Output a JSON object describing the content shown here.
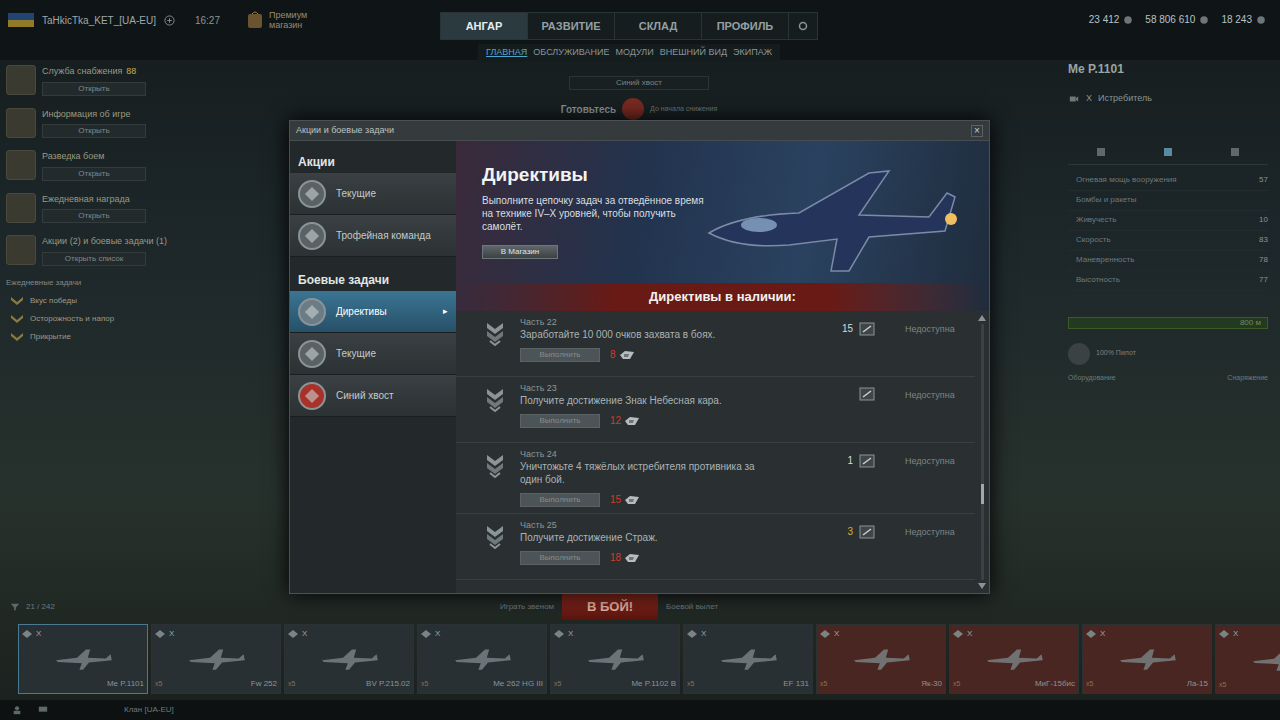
{
  "top_bar": {
    "player": "TaHkicTka_KET_[UA-EU]",
    "time": "16:27",
    "premium": "Премиум",
    "premium_sub": "магазин",
    "nav": [
      {
        "label": "АНГАР",
        "selected": true
      },
      {
        "label": "РАЗВИТИЕ",
        "selected": false
      },
      {
        "label": "СКЛАД",
        "selected": false
      },
      {
        "label": "ПРОФИЛЬ",
        "selected": false
      }
    ],
    "subnav": [
      {
        "label": "ГЛАВНАЯ",
        "selected": true
      },
      {
        "label": "ОБСЛУЖИВАНИЕ",
        "selected": false
      },
      {
        "label": "МОДУЛИ",
        "selected": false
      },
      {
        "label": "ВНЕШНИЙ ВИД",
        "selected": false
      },
      {
        "label": "ЭКИПАЖ",
        "selected": false
      }
    ],
    "currencies": [
      "23 412",
      "58 806 610",
      "18 243"
    ]
  },
  "event": {
    "title": "Синий хвост",
    "status": "Готовьтесь",
    "note": "До начала снижения"
  },
  "sidebar": {
    "items": [
      {
        "title": "Служба снабжения",
        "badge": "88",
        "button": "Открыть"
      },
      {
        "title": "Информация об игре",
        "button": "Открыть"
      },
      {
        "title": "Разведка боем",
        "button": "Открыть"
      },
      {
        "title": "Ежедневная награда",
        "button": "Открыть"
      },
      {
        "title": "Акции (2) и боевые задачи (1)",
        "button": "Открыть список"
      }
    ],
    "daily_heading": "Ежедневные задачи",
    "daily_tasks": [
      "Вкус победы",
      "Осторожность и напор",
      "Прикрытие"
    ]
  },
  "vehicle": {
    "name": "Me P.1101",
    "tier": "X",
    "class": "Истребитель",
    "stats": [
      {
        "label": "Огневая мощь вооружения",
        "value": "57"
      },
      {
        "label": "Бомбы и ракеты"
      },
      {
        "label": "Живучесть",
        "value": "10"
      },
      {
        "label": "Скорость",
        "value": "83"
      },
      {
        "label": "Маневренность",
        "value": "78"
      },
      {
        "label": "Высотность",
        "value": "77"
      }
    ],
    "altitude": {
      "label": "800 м",
      "level": 1
    },
    "pilot": "100% Пилот",
    "equipment": "Оборудование",
    "consumables": "Снаряжение"
  },
  "modal": {
    "title": "Акции и боевые задачи",
    "close": "×",
    "menu_arrow": "▸",
    "sections": [
      {
        "heading": "Акции",
        "items": [
          {
            "label": "Текущие",
            "selected": false,
            "color": "#5a6265"
          },
          {
            "label": "Трофейная команда",
            "selected": false,
            "color": "#5a6265"
          }
        ]
      },
      {
        "heading": "Боевые задачи",
        "items": [
          {
            "label": "Директивы",
            "selected": true,
            "color": "#6c7c86"
          },
          {
            "label": "Текущие",
            "selected": false,
            "color": "#5a6265"
          },
          {
            "label": "Синий хвост",
            "selected": false,
            "color": "#a8322a"
          }
        ]
      }
    ],
    "banner": {
      "title": "Директивы",
      "description": "Выполните цепочку задач за отведённое время на технике IV–X уровней, чтобы получить самолёт.",
      "button": "В Магазин",
      "footer": "Директивы в наличии:"
    },
    "rows": [
      {
        "part": "Часть 22",
        "task": "Заработайте 10 000 очков захвата в боях.",
        "button": "Выполнить",
        "disabled": true,
        "reward": "8",
        "progress": "15",
        "progress_color": "#d6dcdc",
        "status": "Недоступна"
      },
      {
        "part": "Часть 23",
        "task": "Получите достижение Знак Небесная кара.",
        "button": "Выполнить",
        "disabled": true,
        "reward": "12",
        "status": "Недоступна"
      },
      {
        "part": "Часть 24",
        "task": "Уничтожьте 4 тяжёлых истребителя противника за один бой.",
        "button": "Выполнить",
        "disabled": true,
        "reward": "15",
        "progress": "1",
        "progress_color": "#d6dcdc",
        "status": "Недоступна"
      },
      {
        "part": "Часть 25",
        "task": "Получите достижение Страж.",
        "button": "Выполнить",
        "disabled": true,
        "reward": "18",
        "progress": "3",
        "progress_color": "#d8b040",
        "status": "Недоступна"
      }
    ],
    "scrollbar": {
      "level": 0.68
    }
  },
  "battle": {
    "button": "В БОЙ!",
    "left": "Играть звеном",
    "right": "Боевой вылет",
    "count": "21 / 242"
  },
  "carousel": [
    {
      "name": "Me P.1101",
      "tier": "X",
      "selected": true,
      "color": "#283034"
    },
    {
      "name": "Fw 252",
      "tier": "X",
      "count": "x5",
      "selected": false,
      "color": "#283034"
    },
    {
      "name": "BV P.215.02",
      "tier": "X",
      "count": "x5",
      "selected": false,
      "color": "#283034"
    },
    {
      "name": "Me 262 HG III",
      "tier": "X",
      "count": "x5",
      "selected": false,
      "color": "#283034"
    },
    {
      "name": "Me P.1102 B",
      "tier": "X",
      "count": "x5",
      "selected": false,
      "color": "#283034"
    },
    {
      "name": "EF 131",
      "tier": "X",
      "count": "x5",
      "selected": false,
      "color": "#283034"
    },
    {
      "name": "Як-30",
      "tier": "X",
      "count": "x5",
      "selected": false,
      "color": "#4a2622"
    },
    {
      "name": "МиГ-15бис",
      "tier": "X",
      "count": "x5",
      "selected": false,
      "color": "#4a2622"
    },
    {
      "name": "Ла-15",
      "tier": "X",
      "count": "x5",
      "selected": false,
      "color": "#4a2622"
    },
    {
      "tier": "X",
      "count": "x5",
      "selected": false,
      "color": "#4a2622"
    }
  ],
  "status_bar": {
    "clan": "Клан [UA-EU]"
  }
}
